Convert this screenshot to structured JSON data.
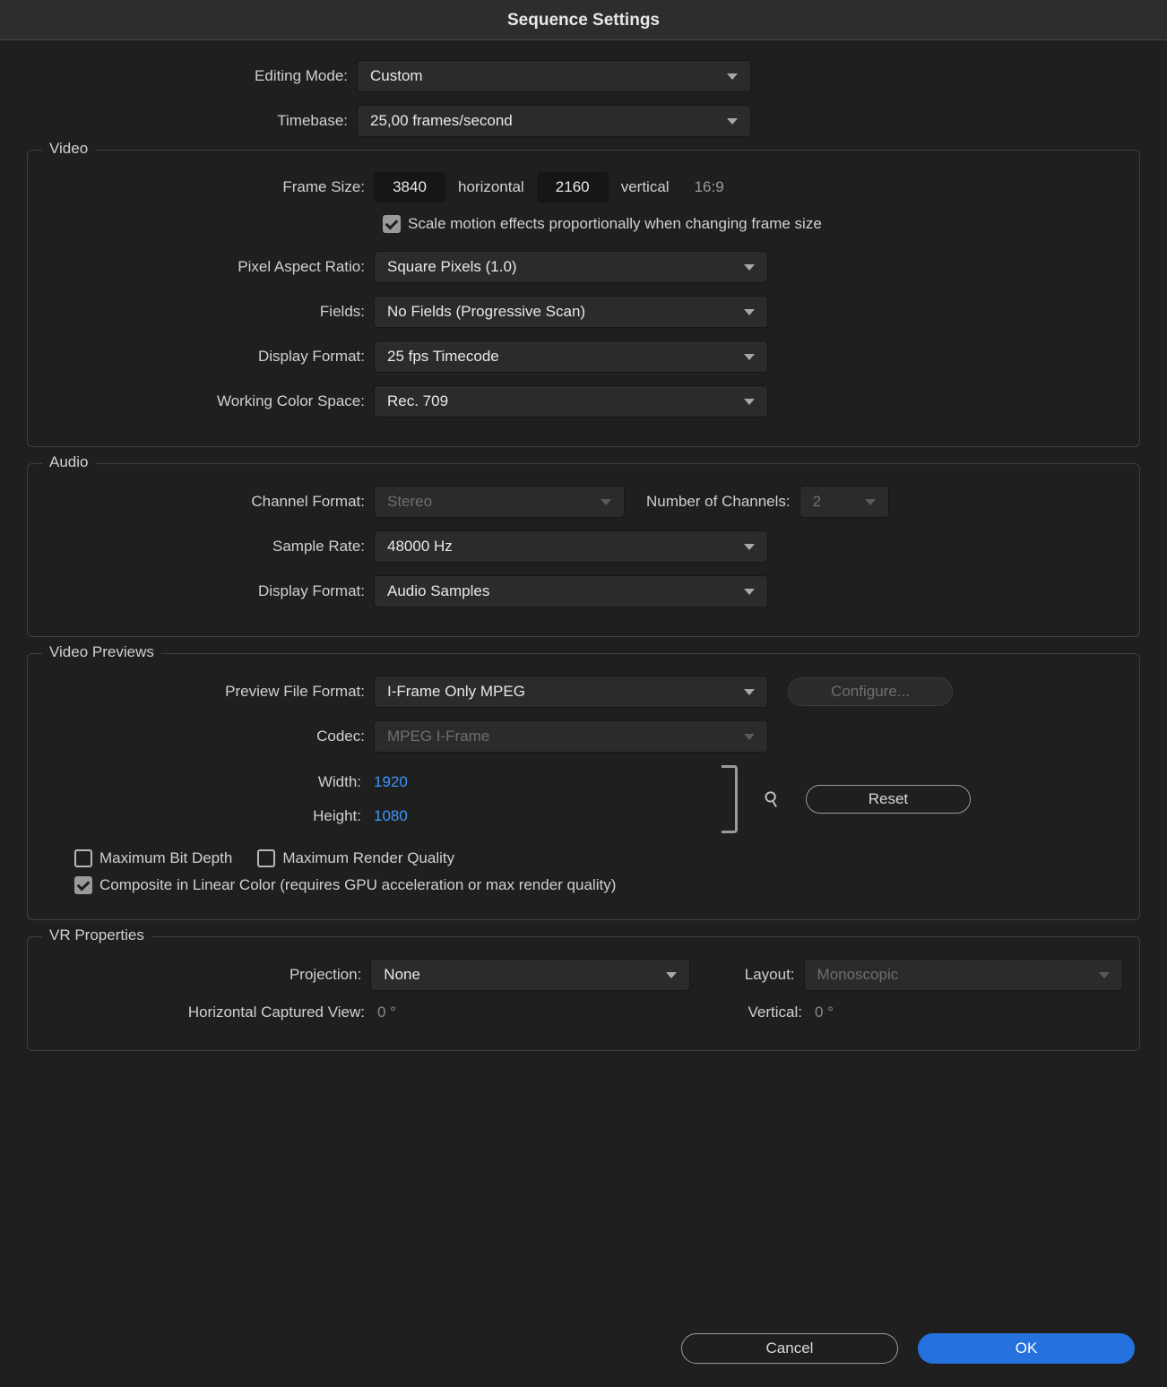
{
  "title": "Sequence Settings",
  "top": {
    "editing_mode_label": "Editing Mode:",
    "editing_mode_value": "Custom",
    "timebase_label": "Timebase:",
    "timebase_value": "25,00  frames/second"
  },
  "video": {
    "group_title": "Video",
    "frame_size_label": "Frame Size:",
    "frame_width": "3840",
    "horizontal_label": "horizontal",
    "frame_height": "2160",
    "vertical_label": "vertical",
    "aspect_text": "16:9",
    "scale_effects_checked": true,
    "scale_effects_label": "Scale motion effects proportionally when changing frame size",
    "par_label": "Pixel Aspect Ratio:",
    "par_value": "Square Pixels (1.0)",
    "fields_label": "Fields:",
    "fields_value": "No Fields (Progressive Scan)",
    "display_format_label": "Display Format:",
    "display_format_value": "25 fps Timecode",
    "color_space_label": "Working Color Space:",
    "color_space_value": "Rec. 709"
  },
  "audio": {
    "group_title": "Audio",
    "channel_format_label": "Channel Format:",
    "channel_format_value": "Stereo",
    "num_channels_label": "Number of Channels:",
    "num_channels_value": "2",
    "sample_rate_label": "Sample Rate:",
    "sample_rate_value": "48000 Hz",
    "display_format_label": "Display Format:",
    "display_format_value": "Audio Samples"
  },
  "previews": {
    "group_title": "Video Previews",
    "file_format_label": "Preview File Format:",
    "file_format_value": "I-Frame Only MPEG",
    "configure_label": "Configure...",
    "codec_label": "Codec:",
    "codec_value": "MPEG I-Frame",
    "width_label": "Width:",
    "width_value": "1920",
    "height_label": "Height:",
    "height_value": "1080",
    "reset_label": "Reset",
    "max_bit_depth_checked": false,
    "max_bit_depth_label": "Maximum Bit Depth",
    "max_render_checked": false,
    "max_render_label": "Maximum Render Quality",
    "composite_checked": true,
    "composite_label": "Composite in Linear Color (requires GPU acceleration or max render quality)"
  },
  "vr": {
    "group_title": "VR Properties",
    "projection_label": "Projection:",
    "projection_value": "None",
    "layout_label": "Layout:",
    "layout_value": "Monoscopic",
    "h_view_label": "Horizontal Captured View:",
    "h_view_value": "0 °",
    "v_view_label": "Vertical:",
    "v_view_value": "0 °"
  },
  "footer": {
    "cancel": "Cancel",
    "ok": "OK"
  }
}
